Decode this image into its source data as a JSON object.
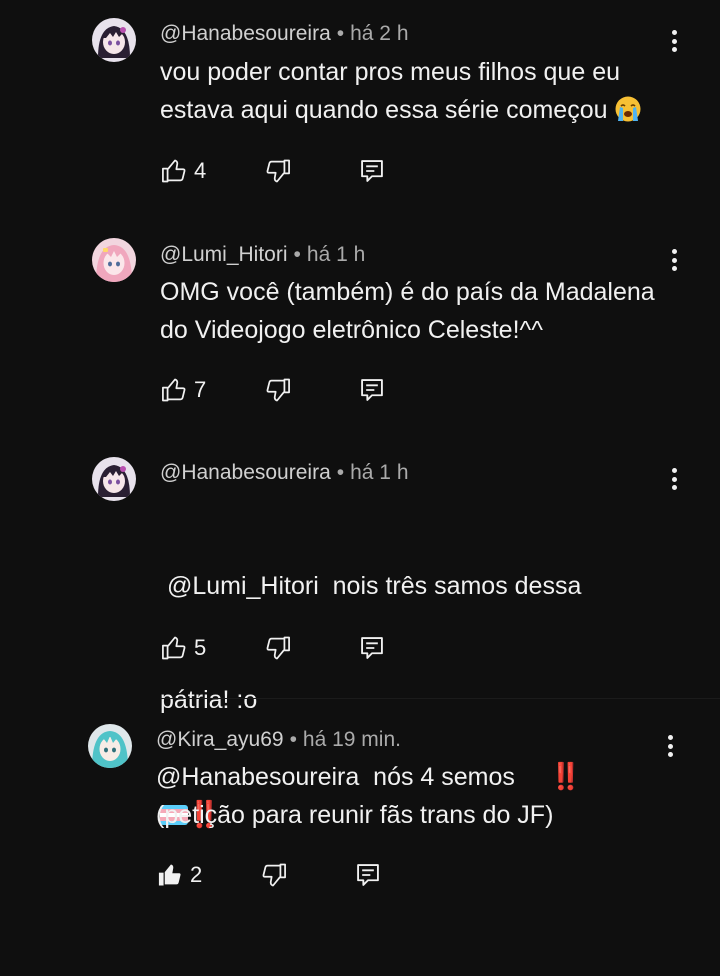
{
  "comments": [
    {
      "handle": "@Hanabesoureira",
      "time": "há 2 h",
      "lines": [
        "vou poder contar pros meus filhos que eu",
        "estava aqui quando essa série começou"
      ],
      "emoji": "loudly-crying-face",
      "likes": "4"
    },
    {
      "handle": "@Lumi_Hitori",
      "time": "há 1 h",
      "lines": [
        "OMG você (também) é do país da Madalena",
        "do Videojogo eletrônico Celeste!^^"
      ],
      "likes": "7"
    },
    {
      "handle": "@Hanabesoureira",
      "time": "há 1 h",
      "lines": [
        " @Lumi_Hitori  nois três samos dessa",
        "pátria! :o"
      ],
      "extra_line": "‼️",
      "likes": "5"
    },
    {
      "handle": "@Kira_ayu69",
      "time": "há 19 min.",
      "lines": [
        "@Hanabesoureira  nós 4 semos",
        "(petição para reunir fãs trans do JF)"
      ],
      "line1_suffix": "‼️",
      "likes": "2"
    }
  ],
  "separator": "•",
  "colors": {
    "background": "#0f0f0f",
    "text": "#f1f1f1",
    "meta": "#aaaaaa",
    "exclamation": "#e0202a",
    "trans_flag_blue": "#5BCEFA",
    "trans_flag_pink": "#F5A9B8"
  },
  "icons": [
    "thumbs-up-icon",
    "thumbs-down-icon",
    "reply-icon",
    "more-vert-icon"
  ]
}
